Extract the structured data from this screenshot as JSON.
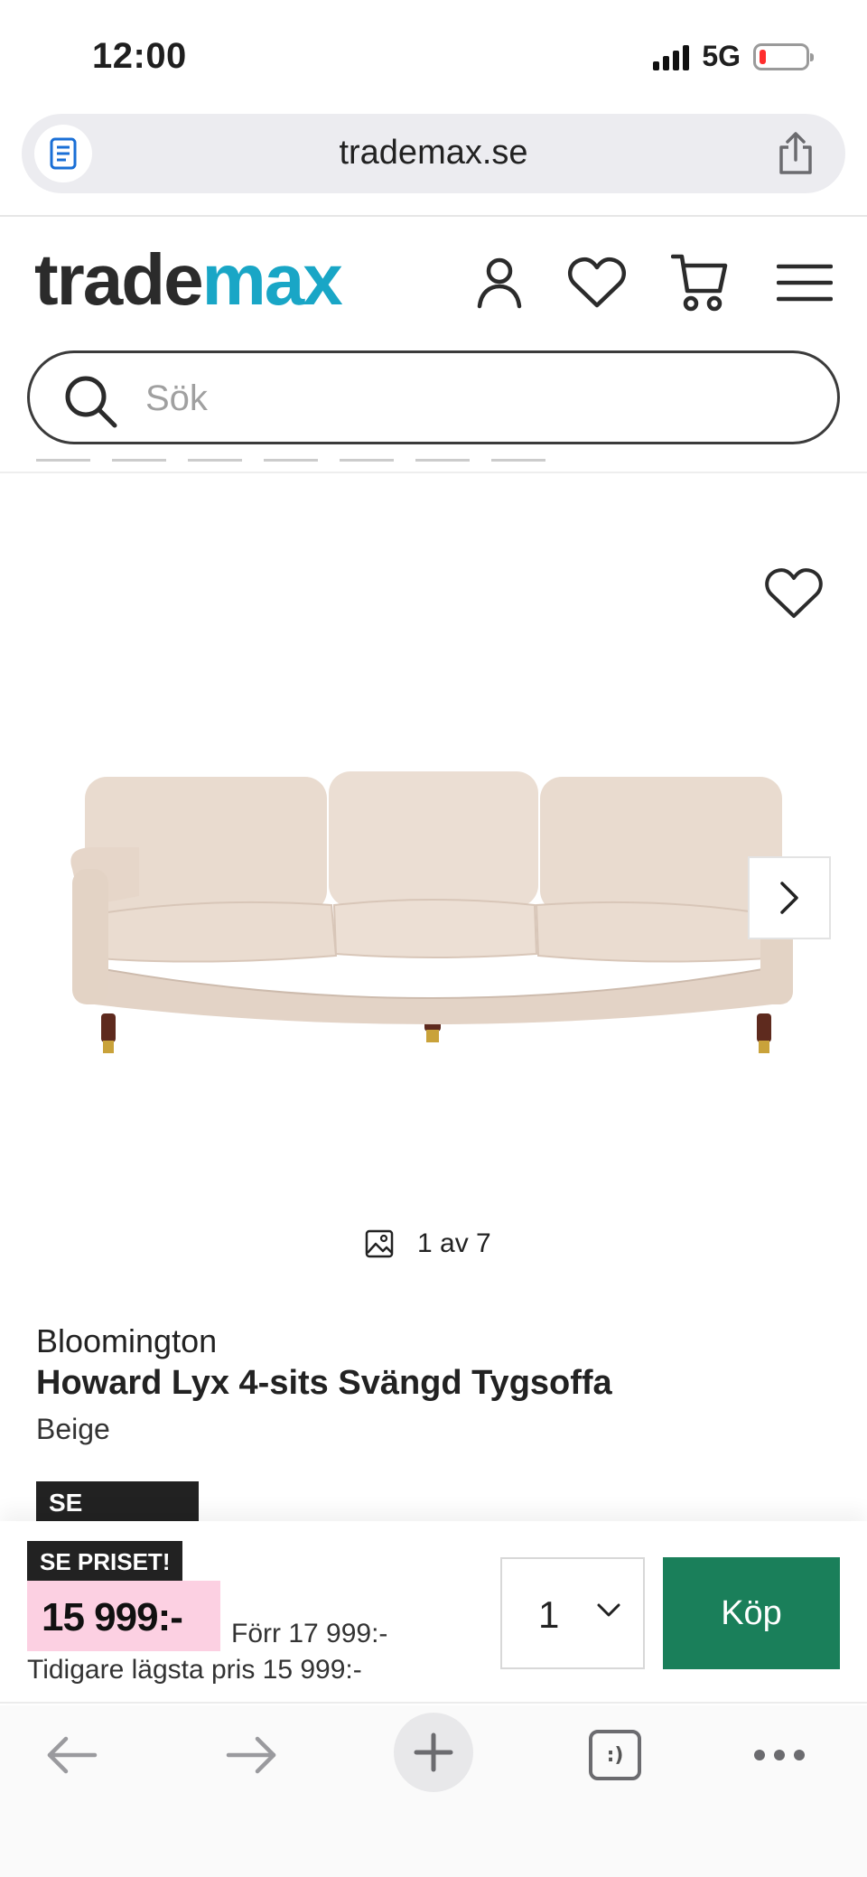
{
  "status_bar": {
    "time": "12:00",
    "network": "5G"
  },
  "browser": {
    "url": "trademax.se"
  },
  "header": {
    "logo_part1": "trade",
    "logo_part2": "max",
    "logo_accent_color": "#19a6c6"
  },
  "search": {
    "placeholder": "Sök"
  },
  "gallery": {
    "counter": "1 av 7"
  },
  "product": {
    "brand": "Bloomington",
    "title": "Howard Lyx 4-sits Svängd Tygsoffa",
    "color": "Beige",
    "badge": "SE PRISET!"
  },
  "buy_bar": {
    "badge": "SE PRISET!",
    "price": "15 999:-",
    "old_price": "Förr 17 999:-",
    "lowest_price": "Tidigare lägsta pris 15 999:-",
    "quantity": "1",
    "buy_label": "Köp",
    "buy_color": "#1a7f5a",
    "price_bg_color": "#fcd0e2"
  },
  "toolbar": {
    "tabs_icon_text": ":)"
  },
  "icons": [
    "reader-icon",
    "share-icon",
    "account-icon",
    "heart-icon",
    "cart-icon",
    "menu-icon",
    "search-icon",
    "wishlist-heart-icon",
    "chevron-right-icon",
    "image-icon",
    "chevron-down-icon",
    "back-arrow-icon",
    "forward-arrow-icon",
    "plus-icon",
    "tabs-icon",
    "more-icon"
  ]
}
